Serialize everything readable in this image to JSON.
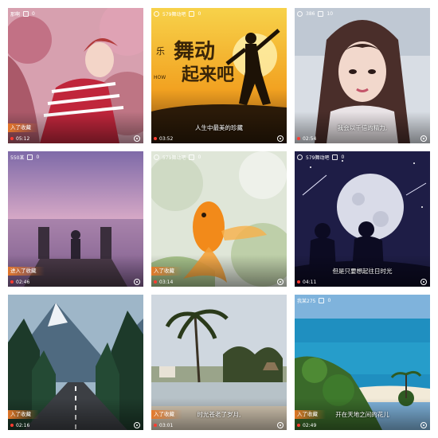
{
  "grid": {
    "tiles": [
      {
        "top_label": "那啊",
        "count": "0",
        "caption": "",
        "tag": "入了收藏",
        "time": "05:12"
      },
      {
        "top_label": "579舞动吧",
        "count": "0",
        "caption": "人生中最美的珍藏",
        "tag": "",
        "time": "03:52"
      },
      {
        "top_label": "386",
        "count": "10",
        "caption": "我会以千倍的精力,",
        "tag": "",
        "time": "02:54"
      },
      {
        "top_label": "550某",
        "count": "0",
        "caption": "",
        "tag": "进入了收藏",
        "time": "02:46"
      },
      {
        "top_label": "579舞动吧",
        "count": "0",
        "caption": "",
        "tag": "入了收藏",
        "time": "03:14"
      },
      {
        "top_label": "579舞动吧",
        "count": "0",
        "caption": "但是只要想起往日时光",
        "tag": "",
        "time": "04:11"
      },
      {
        "top_label": "",
        "count": "",
        "caption": "",
        "tag": "入了收藏",
        "time": "02:16"
      },
      {
        "top_label": "",
        "count": "",
        "caption": "时光苍老了岁月,",
        "tag": "入了收藏",
        "time": "03:01"
      },
      {
        "top_label": "我某275",
        "count": "0",
        "caption": "开在天地之间的花儿",
        "tag": "入了收藏",
        "time": "02:49"
      }
    ],
    "poster_title_line1": "舞动",
    "poster_title_line2": "起来吧",
    "poster_small": "乐",
    "poster_side": "HOW"
  }
}
